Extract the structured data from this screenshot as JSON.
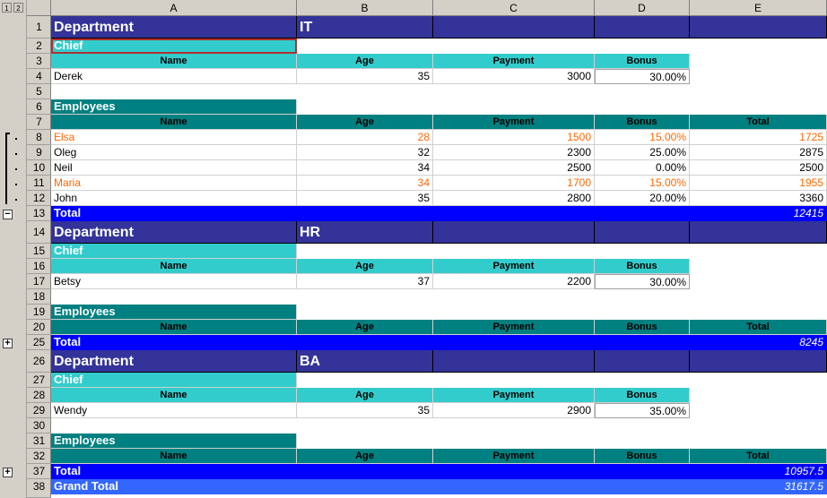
{
  "outline": {
    "levels": [
      "1",
      "2"
    ],
    "collapse": "−",
    "expand": "+"
  },
  "columns": [
    "A",
    "B",
    "C",
    "D",
    "E"
  ],
  "rows": [
    "1",
    "2",
    "3",
    "4",
    "5",
    "6",
    "7",
    "8",
    "9",
    "10",
    "11",
    "12",
    "13",
    "14",
    "15",
    "16",
    "17",
    "18",
    "19",
    "20",
    "25",
    "26",
    "27",
    "28",
    "29",
    "30",
    "31",
    "32",
    "37",
    "38"
  ],
  "labels": {
    "department": "Department",
    "chief": "Chief",
    "employees": "Employees",
    "name": "Name",
    "age": "Age",
    "payment": "Payment",
    "bonus": "Bonus",
    "total": "Total",
    "grand_total": "Grand Total"
  },
  "depts": [
    {
      "code": "IT",
      "chief": {
        "name": "Derek",
        "age": "35",
        "payment": "3000",
        "bonus": "30.00%"
      },
      "employees": [
        {
          "name": "Elsa",
          "age": "28",
          "payment": "1500",
          "bonus": "15.00%",
          "total": "1725"
        },
        {
          "name": "Oleg",
          "age": "32",
          "payment": "2300",
          "bonus": "25.00%",
          "total": "2875"
        },
        {
          "name": "Neil",
          "age": "34",
          "payment": "2500",
          "bonus": "0.00%",
          "total": "2500"
        },
        {
          "name": "Maria",
          "age": "34",
          "payment": "1700",
          "bonus": "15.00%",
          "total": "1955"
        },
        {
          "name": "John",
          "age": "35",
          "payment": "2800",
          "bonus": "20.00%",
          "total": "3360"
        }
      ],
      "total": "12415"
    },
    {
      "code": "HR",
      "chief": {
        "name": "Betsy",
        "age": "37",
        "payment": "2200",
        "bonus": "30.00%"
      },
      "total": "8245"
    },
    {
      "code": "BA",
      "chief": {
        "name": "Wendy",
        "age": "35",
        "payment": "2900",
        "bonus": "35.00%"
      },
      "total": "10957.5"
    }
  ],
  "grand_total": "31617.5",
  "colors": {
    "dept": "#333399",
    "chief": "#33cccc",
    "employees": "#008080",
    "total": "#0000ff",
    "grand": "#3366ff",
    "highlight": "#ff6600"
  }
}
